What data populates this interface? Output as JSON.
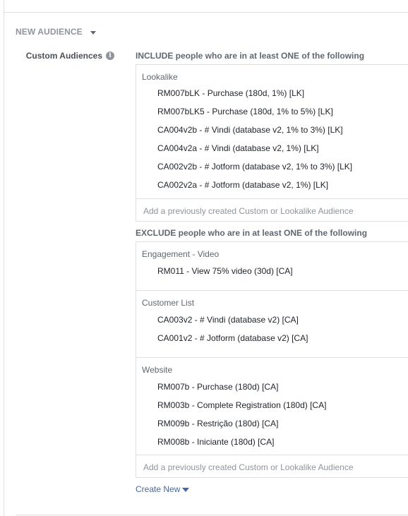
{
  "section": {
    "title": "NEW AUDIENCE"
  },
  "field": {
    "label": "Custom Audiences",
    "info_icon": "info-icon"
  },
  "include": {
    "rule": "INCLUDE people who are in at least ONE of the following",
    "groups": [
      {
        "title": "Lookalike",
        "items": [
          "RM007bLK - Purchase (180d, 1%) [LK]",
          "RM007bLK5 - Purchase (180d, 1% to 5%) [LK]",
          "CA004v2b - # Vindi (database v2, 1% to 3%) [LK]",
          "CA004v2a - # Vindi (database v2, 1%) [LK]",
          "CA002v2b - # Jotform (database v2, 1% to 3%) [LK]",
          "CA002v2a - # Jotform (database v2, 1%) [LK]"
        ]
      }
    ],
    "add_placeholder": "Add a previously created Custom or Lookalike Audience"
  },
  "exclude": {
    "rule": "EXCLUDE people who are in at least ONE of the following",
    "groups": [
      {
        "title": "Engagement - Video",
        "items": [
          "RM011 - View 75% video (30d) [CA]"
        ]
      },
      {
        "title": "Customer List",
        "items": [
          "CA003v2 - # Vindi (database v2) [CA]",
          "CA001v2 - # Jotform (database v2) [CA]"
        ]
      },
      {
        "title": "Website",
        "items": [
          "RM007b - Purchase (180d) [CA]",
          "RM003b - Complete Registration (180d) [CA]",
          "RM009b - Restrição (180d) [CA]",
          "RM008b - Iniciante (180d) [CA]"
        ]
      }
    ],
    "add_placeholder": "Add a previously created Custom or Lookalike Audience"
  },
  "create_new": {
    "label": "Create New"
  },
  "colors": {
    "link": "#4267b2",
    "border": "#dddfe2",
    "muted": "#90949c",
    "text": "#1d2129"
  }
}
